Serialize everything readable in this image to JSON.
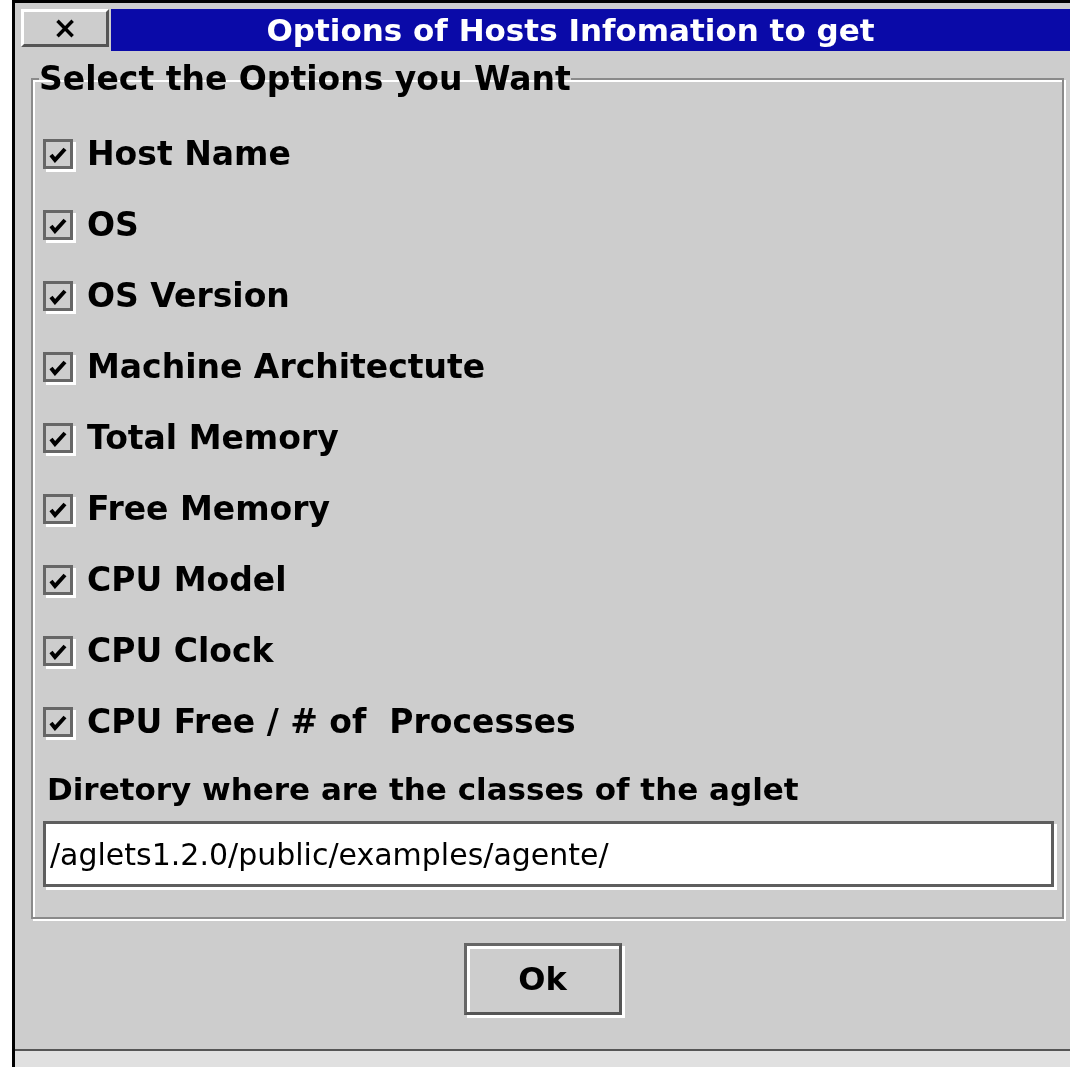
{
  "window": {
    "close": "×",
    "title": "Options of Hosts Infomation to get"
  },
  "group": {
    "title": "Select the Options you Want",
    "options": [
      {
        "label": "Host Name",
        "checked": true
      },
      {
        "label": "OS",
        "checked": true
      },
      {
        "label": "OS Version",
        "checked": true
      },
      {
        "label": "Machine Architectute",
        "checked": true
      },
      {
        "label": "Total Memory",
        "checked": true
      },
      {
        "label": "Free Memory",
        "checked": true
      },
      {
        "label": "CPU Model",
        "checked": true
      },
      {
        "label": "CPU Clock",
        "checked": true
      },
      {
        "label": "CPU Free / # of  Processes",
        "checked": true
      }
    ],
    "directory_label": "Diretory where are the classes of the aglet",
    "directory_value": "/aglets1.2.0/public/examples/agente/"
  },
  "buttons": [
    "Ok"
  ]
}
